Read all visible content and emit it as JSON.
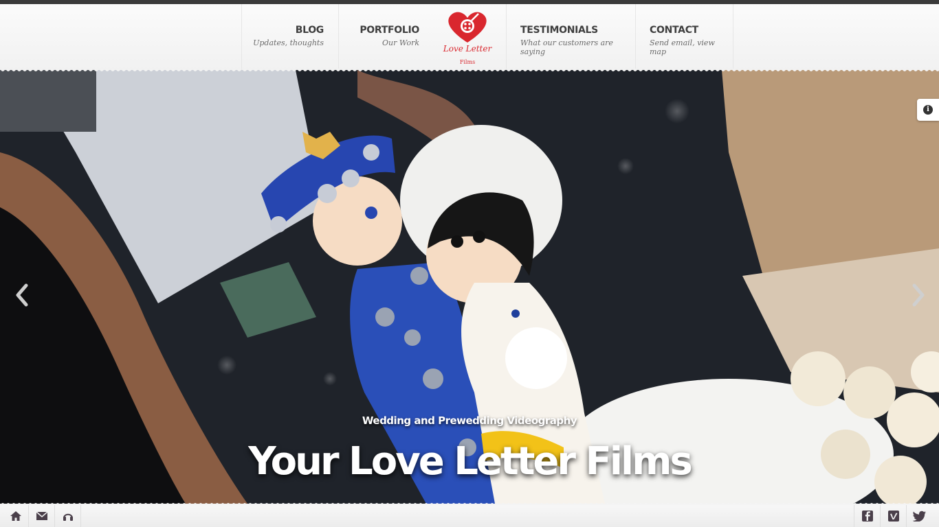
{
  "nav": {
    "blog": {
      "title": "BLOG",
      "subtitle": "Updates, thoughts"
    },
    "portfolio": {
      "title": "PORTFOLIO",
      "subtitle": "Our Work"
    },
    "testimonials": {
      "title": "TESTIMONIALS",
      "subtitle": "What our customers are saying"
    },
    "contact": {
      "title": "CONTACT",
      "subtitle": "Send email, view map"
    }
  },
  "logo": {
    "text": "Love Letter",
    "sub": "Films",
    "icon": "heart-film-reel-icon",
    "color": "#d9272e"
  },
  "hero": {
    "subtitle": "Wedding and Prewedding Videography",
    "title": "Your Love Letter Films",
    "image_description": "wedding-cake-topper-couple-photo"
  },
  "icons": {
    "info": "info-icon",
    "prev": "chevron-left-icon",
    "next": "chevron-right-icon",
    "home": "home-icon",
    "mail": "mail-icon",
    "music": "headphones-icon",
    "facebook": "facebook-icon",
    "vimeo": "vimeo-icon",
    "twitter": "twitter-icon"
  },
  "info_glyph": "i",
  "colors": {
    "accent": "#d9272e",
    "icon": "#4a3f4a",
    "bar": "#3a3a3a"
  }
}
